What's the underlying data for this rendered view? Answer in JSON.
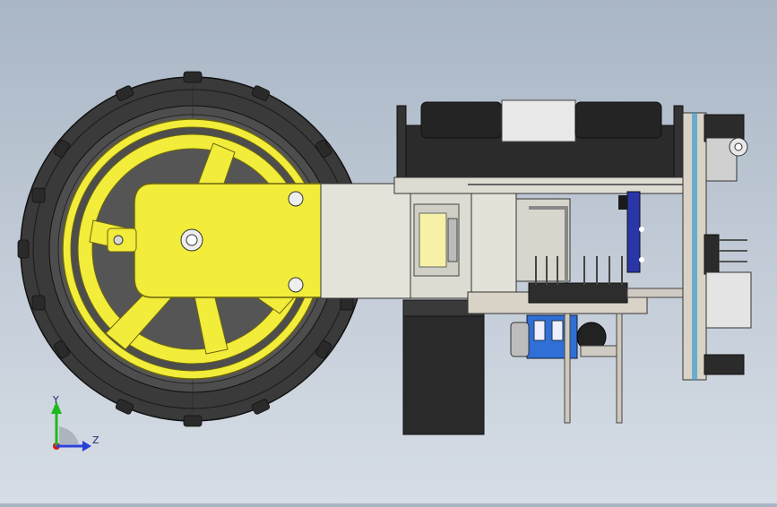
{
  "viewport": {
    "background_top": "#a9b6c6",
    "background_bottom": "#d6dde5"
  },
  "model": {
    "tire_color": "#3a3a3a",
    "hub_color": "#f2ec3a",
    "body_color": "#2b2b2b",
    "bracket_color": "#d8d8d0",
    "pcb_color": "#d9d2c7",
    "terminal_color": "#2f6fd6",
    "accent_blue": "#2a35a8"
  },
  "triad": {
    "y_label": "Y",
    "z_label": "Z",
    "y_color": "#1fb81f",
    "z_color": "#2b40d8",
    "x_color": "#d41a1a"
  }
}
